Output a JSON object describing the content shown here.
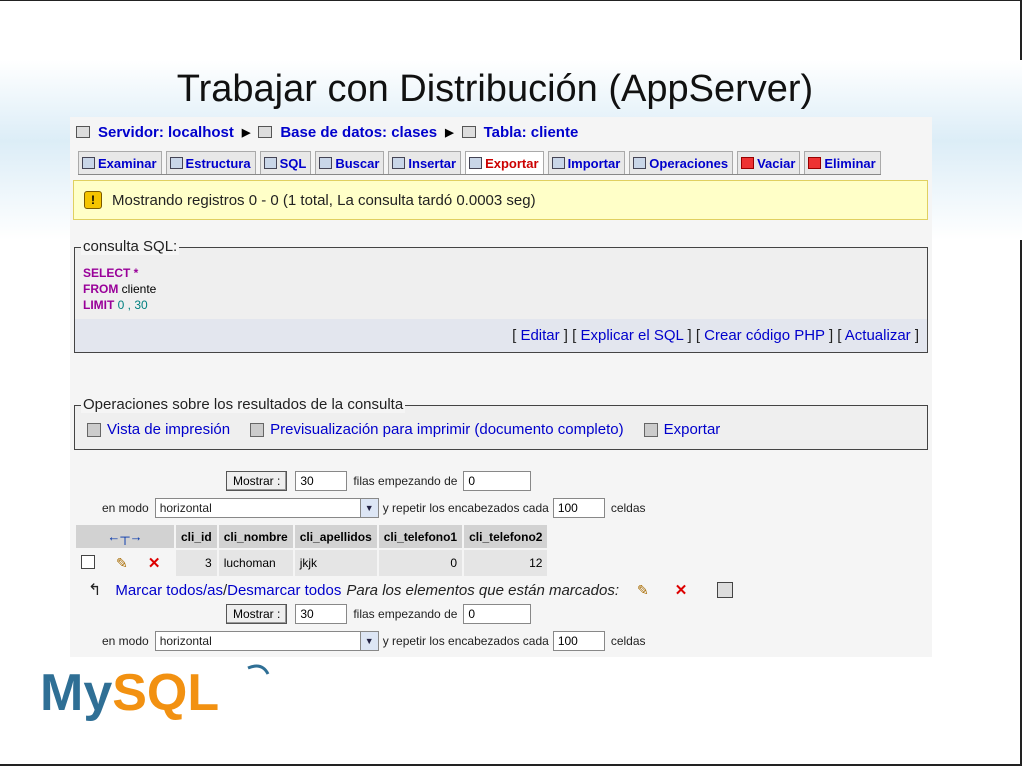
{
  "slide": {
    "title": "Trabajar con Distribución (AppServer)"
  },
  "breadcrumb": {
    "server": "Servidor: localhost",
    "database": "Base de datos: clases",
    "table": "Tabla: cliente"
  },
  "tabs": [
    {
      "label": "Examinar",
      "icon": "browse-icon",
      "active": false
    },
    {
      "label": "Estructura",
      "icon": "structure-icon",
      "active": false
    },
    {
      "label": "SQL",
      "icon": "sql-icon",
      "active": false
    },
    {
      "label": "Buscar",
      "icon": "search-icon",
      "active": false
    },
    {
      "label": "Insertar",
      "icon": "insert-icon",
      "active": false
    },
    {
      "label": "Exportar",
      "icon": "export-icon",
      "active": true
    },
    {
      "label": "Importar",
      "icon": "import-icon",
      "active": false
    },
    {
      "label": "Operaciones",
      "icon": "operations-icon",
      "active": false
    },
    {
      "label": "Vaciar",
      "icon": "empty-icon",
      "active": false
    },
    {
      "label": "Eliminar",
      "icon": "drop-icon",
      "active": false
    }
  ],
  "notice": {
    "text": "Mostrando registros 0 - 0 (1 total, La consulta tardó 0.0003 seg)"
  },
  "sql_box": {
    "legend": "consulta SQL:",
    "line1_kw": "SELECT",
    "line1_rest": " *",
    "line2_kw": "FROM",
    "line2_rest": " cliente",
    "line3_kw": "LIMIT",
    "line3_a": " 0",
    "line3_sep": " , ",
    "line3_b": "30"
  },
  "sql_links": {
    "edit": "Editar",
    "explain": "Explicar el SQL",
    "php": "Crear código PHP",
    "refresh": "Actualizar"
  },
  "operations": {
    "legend": "Operaciones sobre los resultados de la consulta",
    "print_view": "Vista de impresión",
    "print_preview": "Previsualización para imprimir (documento completo)",
    "export": "Exportar"
  },
  "nav_controls": {
    "show_button": "Mostrar :",
    "rows_value": "30",
    "start_label": "filas empezando de",
    "start_value": "0",
    "mode_label": "en modo",
    "mode_value": "horizontal",
    "repeat_label": "y repetir los encabezados cada",
    "repeat_value": "100",
    "cells_label": "celdas"
  },
  "results": {
    "columns": [
      "cli_id",
      "cli_nombre",
      "cli_apellidos",
      "cli_telefono1",
      "cli_telefono2"
    ],
    "rows": [
      {
        "cli_id": "3",
        "cli_nombre": "luchoman",
        "cli_apellidos": "jkjk",
        "cli_telefono1": "0",
        "cli_telefono2": "12"
      }
    ]
  },
  "bulk": {
    "mark_all": "Marcar todos/as",
    "divider": " / ",
    "unmark_all": "Desmarcar todos",
    "with_selected": "Para los elementos que están marcados:"
  },
  "logo": {
    "text": "MySQL"
  },
  "colors": {
    "link": "#0000cc",
    "active_tab": "#cc0000",
    "notice_bg": "#ffffc8",
    "sql_keyword": "#990099",
    "sql_number": "#008080"
  }
}
